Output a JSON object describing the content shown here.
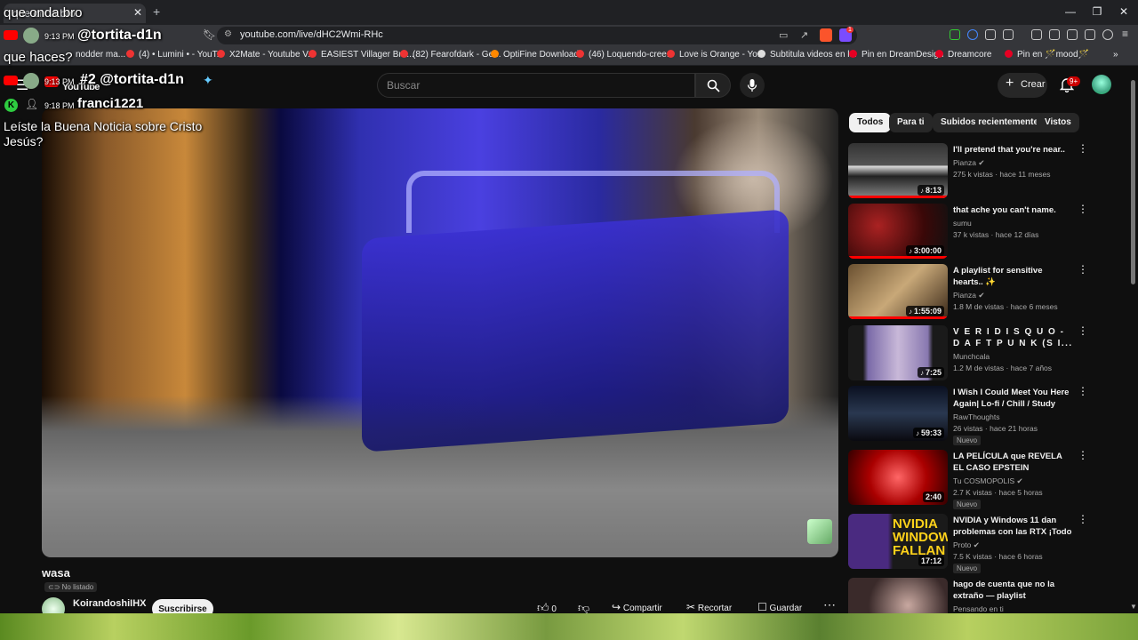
{
  "browser": {
    "tab_title": "que onda bro",
    "url": "youtube.com/live/dHC2Wmi-RHc",
    "bookmarks": [
      {
        "label": "nodder ma..."
      },
      {
        "label": "(4) • Lumini • - YouT..."
      },
      {
        "label": "X2Mate - Youtube V..."
      },
      {
        "label": "EASIEST Villager Bre..."
      },
      {
        "label": "(82) Fearofdark - Ge..."
      },
      {
        "label": "OptiFine Download"
      },
      {
        "label": "(46) Loquendo-cree..."
      },
      {
        "label": "Love is Orange - Yo..."
      },
      {
        "label": "Subtitula videos en l..."
      },
      {
        "label": "Pin en DreamDesign"
      },
      {
        "label": "Dreamcore"
      },
      {
        "label": "Pin en 🪄mood🪄"
      }
    ],
    "extension_badge": "1"
  },
  "overlay_chat": {
    "line1_text": "que onda bro",
    "msg1_time": "9:13 PM",
    "msg1_user": "@tortita-d1n",
    "line2_text": "que haces?",
    "msg2_time": "9:13 PM",
    "msg2_user": "#2 @tortita-d1n",
    "msg3_time": "9:18 PM",
    "msg3_user": "franci1221",
    "msg3_text": "Leíste la Buena Noticia sobre Cristo Jesús?",
    "msg3_line1": "Leíste la Buena Noticia sobre Cristo",
    "msg3_line2": "Jesús?",
    "yt_logo_text": "YouTube"
  },
  "header": {
    "search_placeholder": "Buscar",
    "create_label": "Crear",
    "notif_badge": "9+"
  },
  "video": {
    "title": "wasa",
    "visibility": "No listado",
    "channel": "KoirandoshiIHX",
    "subscribe_label": "Suscribirse",
    "likes": "0",
    "share_label": "Compartir",
    "clip_label": "Recortar",
    "save_label": "Guardar"
  },
  "sidebar": {
    "chips": [
      {
        "label": "Todos",
        "active": true
      },
      {
        "label": "Para ti",
        "active": false
      },
      {
        "label": "Subidos recientemente",
        "active": false
      },
      {
        "label": "Vistos",
        "active": false
      }
    ],
    "videos": [
      {
        "title": "I'll pretend that you're near..",
        "channel": "Pianza",
        "meta": "275 k vistas · hace 11 meses",
        "duration": "8:13",
        "badge": "",
        "progress": 1.0
      },
      {
        "title": "that ache you can't name.",
        "channel": "sumu",
        "meta": "37 k vistas · hace 12 días",
        "duration": "3:00:00",
        "badge": "",
        "progress": 1.0
      },
      {
        "title": "A playlist for sensitive hearts.. ✨",
        "channel": "Pianza",
        "meta": "1.8 M de vistas · hace 6 meses",
        "duration": "1:55:09",
        "badge": "",
        "progress": 1.0
      },
      {
        "title": "V E R I D I S Q U O - D A F T P U N K (S I...",
        "channel": "Munchcala",
        "meta": "1.2 M de vistas · hace 7 años",
        "duration": "7:25",
        "badge": "",
        "progress": 0
      },
      {
        "title": "I Wish I Could Meet You Here Again| Lo-fi / Chill / Study Music",
        "channel": "RawThoughts",
        "meta": "26 vistas · hace 21 horas",
        "duration": "59:33",
        "badge": "Nuevo",
        "progress": 0
      },
      {
        "title": "LA PELÍCULA que REVELA EL CASO EPSTEIN",
        "channel": "Tu COSMOPOLIS",
        "meta": "2.7 K vistas · hace 5 horas",
        "duration": "2:40",
        "badge": "Nuevo",
        "progress": 0
      },
      {
        "title": "NVIDIA y Windows 11 dan problemas con las RTX ¡Todo ...",
        "channel": "Proto",
        "meta": "7.5 K vistas · hace 6 horas",
        "duration": "17:12",
        "badge": "Nuevo",
        "progress": 0
      },
      {
        "title": "hago de cuenta que no la extraño — playlist",
        "channel": "Pensando en ti",
        "meta": "",
        "duration": "",
        "badge": "",
        "progress": 0
      }
    ]
  },
  "colors": {
    "accent": "#ff0000",
    "bg": "#0f0f0f",
    "chip_active": "#f1f1f1"
  }
}
